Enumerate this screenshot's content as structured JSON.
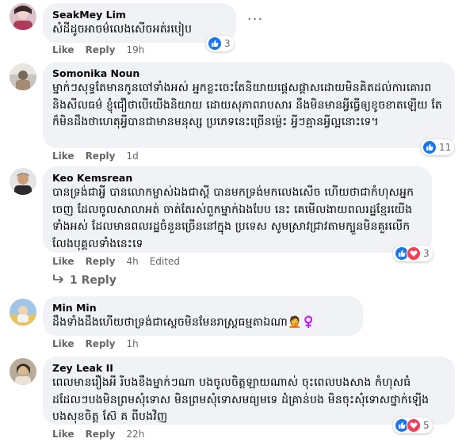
{
  "comments": [
    {
      "author": "SeakMey Lim",
      "text": "សំដីដូចអាចម៌លេងសើចអត់របៀប",
      "actions": {
        "like": "Like",
        "reply": "Reply",
        "time": "19h"
      },
      "reactions": {
        "count": "3",
        "types": [
          "like"
        ]
      }
    },
    {
      "author": "Somonika Noun",
      "text": "ម្នាក់ៗសុទ្ធតែមានកូនចៅទាំងអស់ អ្នកខ្លះចេះតែនិយាយផ្ដេសផ្ដាសដោយមិនគិតដល់ការគោរព និងសីលធម៌ ខ្ញុំជឿថាបើយើងនិយាយ ដោយសុភាពរាបសារ នឹងមិនមានអ្វីធ្វើឲ្យខូចខាតឡើយ តែក៏មិនដឹងថាហេតុអ្វីបានជាមានមនុស្ស ប្រភេទនេះច្រើនម្ល៉េះ អ្វីៗគ្មានអ្វីល្អនោះទេ។",
      "actions": {
        "like": "Like",
        "reply": "Reply",
        "time": "1d"
      },
      "reactions": {
        "count": "11",
        "types": [
          "like"
        ]
      }
    },
    {
      "author": "Keo Kemsrean",
      "text": "បានទ្រង់ជាអ្វី បានលោកម្ចាស់ឯងជាស្ដី បានមកទ្រង់មកលេងសើច ហើយថាជាកំហុសអ្នកចេញ ដែលចូលសាលាអត់ ចាត់តែរស់ពួកម្នាក់ឯងបែប នេះ គេមើលងាយពលរដ្ឋខ្មែរយើងទាំងអស់ ដែលមានពលរដ្ឋចំនួនច្រើននៅក្នុង ប្រទេស សូមស្រាវជ្រាវតាមក្បួនមិនគួរលើកលែងបុគ្គលទាំងនេះទេ",
      "actions": {
        "like": "Like",
        "reply": "Reply",
        "time": "4h",
        "edited": "Edited"
      },
      "reactions": {
        "count": "3",
        "types": [
          "like",
          "love"
        ]
      },
      "replies_label": "1 Reply"
    },
    {
      "author": "Min Min",
      "text": "ដឹងទាំងដឹងហើយថាទ្រង់ជាស្ដេចមិនមែនរាស្ត្រធម្មតាឯណា🤦‍♀️",
      "actions": {
        "like": "Like",
        "reply": "Reply",
        "time": "1h"
      }
    },
    {
      "author": "Zey Leak II",
      "text": "ពេលមានរឿងអី រីបងខឹងម្នាក់ៗណា បងចូលចិត្តឡាយណាស់ ចុះពេលបងសាង កំហុសធំដដែលៗបងមិនព្រមសុំទោស មិនព្រមសុំទោសមធ្យមទេ ដំគ្រាន់បង មិនចុះសុំទោសថ្នាក់ឡើង បងសុខចិត្ត ស៊ែ គ ពីបងវិញ",
      "actions": {
        "like": "Like",
        "reply": "Reply",
        "time": "22h"
      },
      "reactions": {
        "count": "5",
        "types": [
          "like",
          "love"
        ]
      }
    }
  ],
  "colors": {
    "like": "#1877f2",
    "love": "#f33e58",
    "bubble": "#f0f2f5",
    "meta": "#65676b"
  },
  "icons": [
    "like-icon",
    "love-icon",
    "more-options-icon",
    "reply-arrow-icon",
    "avatar"
  ]
}
